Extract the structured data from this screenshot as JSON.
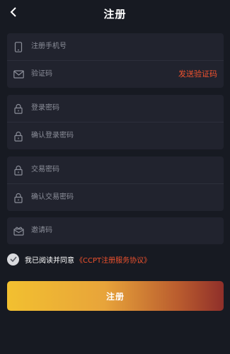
{
  "header": {
    "back_icon": "chevron-left-icon",
    "title": "注册"
  },
  "form": {
    "phone": {
      "icon": "phone-icon",
      "placeholder": "注册手机号"
    },
    "code": {
      "icon": "mail-icon",
      "placeholder": "验证码",
      "send_label": "发送验证码"
    },
    "login_password": {
      "icon": "lock-icon",
      "placeholder": "登录密码"
    },
    "confirm_login_password": {
      "icon": "lock-icon",
      "placeholder": "确认登录密码"
    },
    "trade_password": {
      "icon": "lock-icon",
      "placeholder": "交易密码"
    },
    "confirm_trade_password": {
      "icon": "lock-icon",
      "placeholder": "确认交易密码"
    },
    "invite_code": {
      "icon": "gift-icon",
      "placeholder": "邀请码"
    }
  },
  "agreement": {
    "checked": true,
    "text": "我已阅读并同意",
    "link": "《CCPT注册服务协议》"
  },
  "submit_label": "注册",
  "colors": {
    "background": "#171a22",
    "card": "#21232e",
    "accent": "#f0522e",
    "button_start": "#f2c030",
    "button_end": "#8f2f2a"
  }
}
